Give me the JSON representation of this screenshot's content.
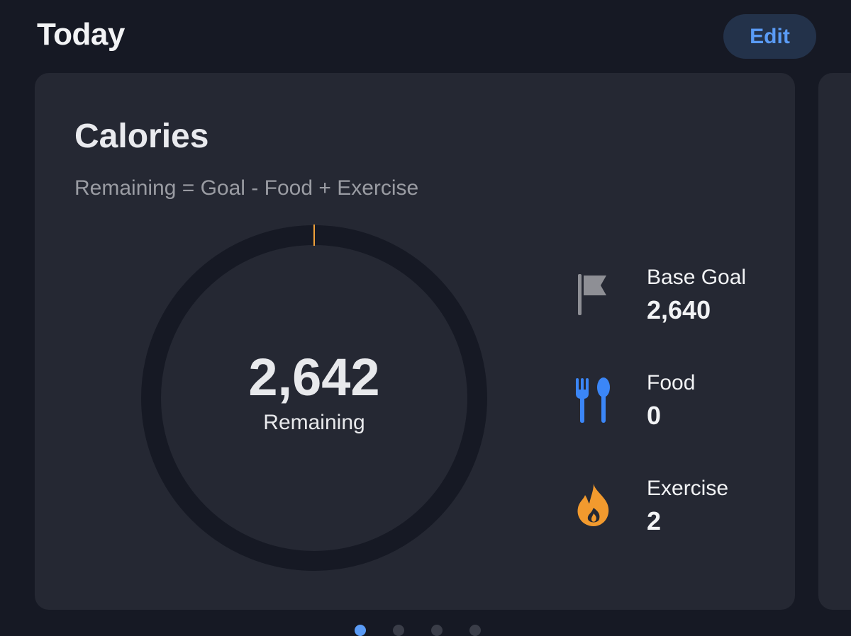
{
  "header": {
    "title": "Today",
    "edit_label": "Edit"
  },
  "card": {
    "title": "Calories",
    "subtitle": "Remaining = Goal - Food + Exercise",
    "ring": {
      "value": "2,642",
      "label": "Remaining",
      "progress_fraction": 0.001,
      "track_color": "#161924",
      "progress_color": "#f0a13a"
    },
    "stats": [
      {
        "label": "Base Goal",
        "value": "2,640",
        "icon": "flag-icon",
        "color": "#8e8f95"
      },
      {
        "label": "Food",
        "value": "0",
        "icon": "fork-spoon-icon",
        "color": "#3b86f7"
      },
      {
        "label": "Exercise",
        "value": "2",
        "icon": "flame-icon",
        "color": "#f29a2e"
      }
    ]
  },
  "pager": {
    "count": 4,
    "active_index": 0
  },
  "colors": {
    "background": "#161924",
    "card": "#252833",
    "accent": "#5a9bf5"
  }
}
